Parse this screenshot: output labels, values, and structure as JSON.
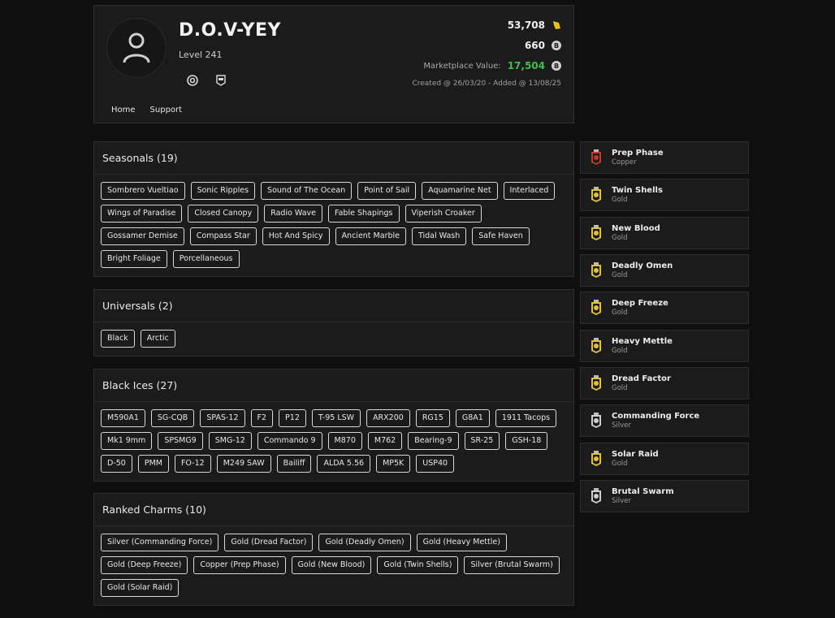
{
  "profile": {
    "username": "D.O.V-YEY",
    "level": "Level 241",
    "credits": "53,708",
    "renown": "660",
    "marketplace_label": "Marketplace Value:",
    "marketplace_value": "17,504",
    "created": "Created @ 26/03/20 - Added @ 13/08/25",
    "nav": [
      "Home",
      "Support"
    ],
    "platform_icons": [
      "ubisoft-icon",
      "epic-games-icon"
    ],
    "currency_icons": [
      "credits-icon",
      "renown-coin-icon",
      "marketplace-coin-icon"
    ],
    "colors": {
      "marketplace_value": "#3fbf4f",
      "credits_icon": "#e8c21a"
    }
  },
  "sections": {
    "seasonals": {
      "title": "Seasonals (19)",
      "tags": [
        "Sombrero Vueltiao",
        "Sonic Ripples",
        "Sound of The Ocean",
        "Point of Sail",
        "Aquamarine Net",
        "Interlaced",
        "Wings of Paradise",
        "Closed Canopy",
        "Radio Wave",
        "Fable Shapings",
        "Viperish Croaker",
        "Gossamer Demise",
        "Compass Star",
        "Hot And Spicy",
        "Ancient Marble",
        "Tidal Wash",
        "Safe Haven",
        "Bright Foliage",
        "Porcellaneous"
      ]
    },
    "universals": {
      "title": "Universals (2)",
      "tags": [
        "Black",
        "Arctic"
      ]
    },
    "blackices": {
      "title": "Black Ices (27)",
      "tags": [
        "M590A1",
        "SG-CQB",
        "SPAS-12",
        "F2",
        "P12",
        "T-95 LSW",
        "ARX200",
        "RG15",
        "G8A1",
        "1911 Tacops",
        "Mk1 9mm",
        "SPSMG9",
        "SMG-12",
        "Commando 9",
        "M870",
        "M762",
        "Bearing-9",
        "SR-25",
        "GSH-18",
        "D-50",
        "PMM",
        "FO-12",
        "M249 SAW",
        "Bailiff",
        "ALDA 5.56",
        "MP5K",
        "USP40"
      ]
    },
    "ranked": {
      "title": "Ranked Charms (10)",
      "tags": [
        "Silver (Commanding Force)",
        "Gold (Dread Factor)",
        "Gold (Deadly Omen)",
        "Gold (Heavy Mettle)",
        "Gold (Deep Freeze)",
        "Copper (Prep Phase)",
        "Gold (New Blood)",
        "Gold (Twin Shells)",
        "Silver (Brutal Swarm)",
        "Gold (Solar Raid)"
      ]
    }
  },
  "charms": [
    {
      "name": "Prep Phase",
      "tier": "Copper",
      "color": "#c0392b"
    },
    {
      "name": "Twin Shells",
      "tier": "Gold",
      "color": "#e2c23a"
    },
    {
      "name": "New Blood",
      "tier": "Gold",
      "color": "#e2c23a"
    },
    {
      "name": "Deadly Omen",
      "tier": "Gold",
      "color": "#e2c23a"
    },
    {
      "name": "Deep Freeze",
      "tier": "Gold",
      "color": "#e2c23a"
    },
    {
      "name": "Heavy Mettle",
      "tier": "Gold",
      "color": "#e2c23a"
    },
    {
      "name": "Dread Factor",
      "tier": "Gold",
      "color": "#e2c23a"
    },
    {
      "name": "Commanding Force",
      "tier": "Silver",
      "color": "#cfcfcf"
    },
    {
      "name": "Solar Raid",
      "tier": "Gold",
      "color": "#e2c23a"
    },
    {
      "name": "Brutal Swarm",
      "tier": "Silver",
      "color": "#cfcfcf"
    }
  ]
}
